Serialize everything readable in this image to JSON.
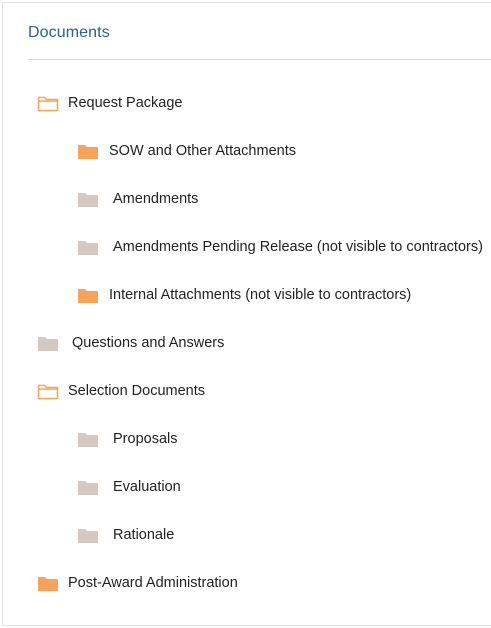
{
  "panel": {
    "title": "Documents"
  },
  "tree": [
    {
      "label": "Request Package",
      "icon": "folder-open-icon",
      "color": "#f7a35c"
    },
    {
      "label": "SOW and Other Attachments",
      "icon": "folder-filled-icon",
      "color": "#f7a35c"
    },
    {
      "label": "Amendments",
      "icon": "folder-filled-icon",
      "color": "#d4c9c2"
    },
    {
      "label": "Amendments Pending Release (not visible to contractors)",
      "icon": "folder-filled-icon",
      "color": "#d4c9c2"
    },
    {
      "label": "Internal Attachments (not visible to contractors)",
      "icon": "folder-filled-icon",
      "color": "#f7a35c"
    },
    {
      "label": "Questions and Answers",
      "icon": "folder-filled-icon",
      "color": "#d4c9c2"
    },
    {
      "label": "Selection Documents",
      "icon": "folder-open-icon",
      "color": "#f7a35c"
    },
    {
      "label": "Proposals",
      "icon": "folder-filled-icon",
      "color": "#d4c9c2"
    },
    {
      "label": "Evaluation",
      "icon": "folder-filled-icon",
      "color": "#d4c9c2"
    },
    {
      "label": "Rationale",
      "icon": "folder-filled-icon",
      "color": "#d4c9c2"
    },
    {
      "label": "Post-Award Administration",
      "icon": "folder-filled-icon",
      "color": "#f7a35c"
    }
  ]
}
